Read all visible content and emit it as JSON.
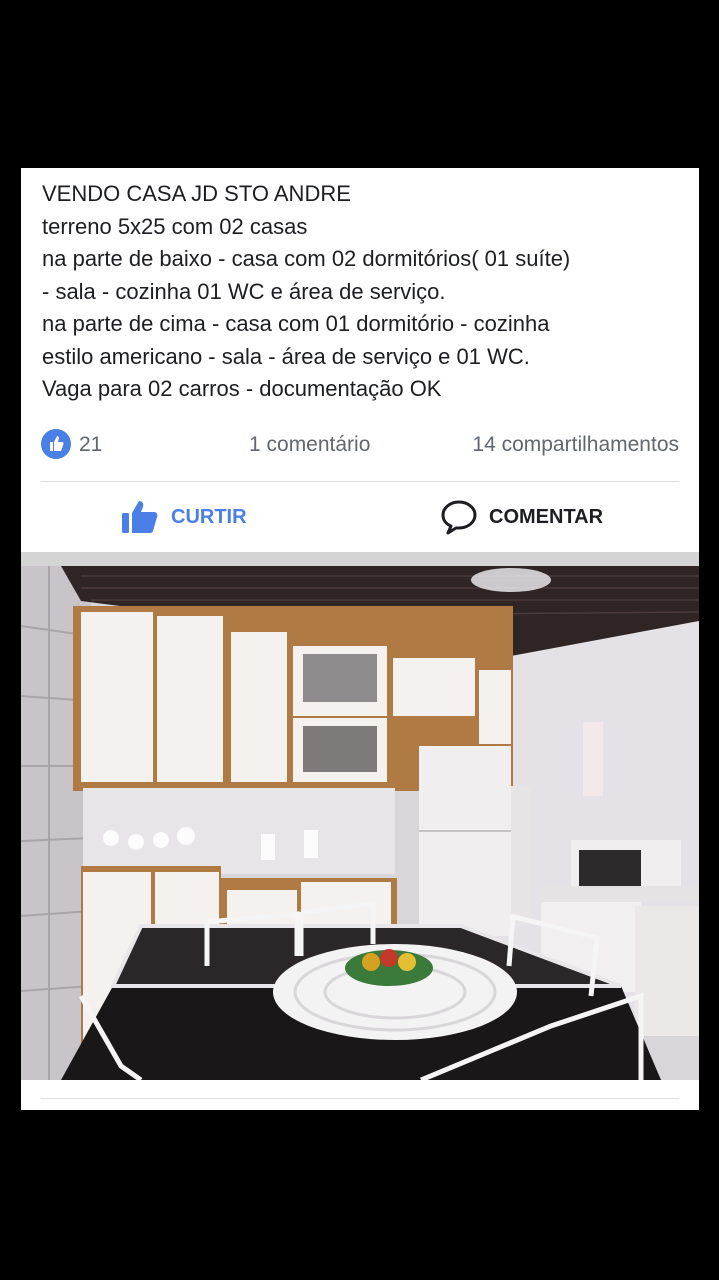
{
  "post": {
    "lines": [
      "VENDO CASA JD  STO ANDRE",
      "terreno 5x25 com 02 casas",
      "na parte de baixo - casa com 02 dormitórios( 01 suíte)",
      "- sala - cozinha 01 WC e área de serviço.",
      "na parte de cima - casa com 01 dormitório - cozinha",
      "estilo americano - sala - área de serviço e 01 WC.",
      "Vaga para 02 carros - documentação OK"
    ]
  },
  "stats": {
    "likes": "21",
    "comments": "1 comentário",
    "shares": "14 compartilhamentos",
    "like_icon": "thumbs-up-icon"
  },
  "actions": {
    "like_label": "CURTIR",
    "comment_label": "COMENTAR",
    "like_icon": "thumbs-up-icon",
    "comment_icon": "speech-bubble-icon"
  },
  "colors": {
    "accent": "#4a7fe8",
    "background": "#000000",
    "card": "#ffffff"
  }
}
